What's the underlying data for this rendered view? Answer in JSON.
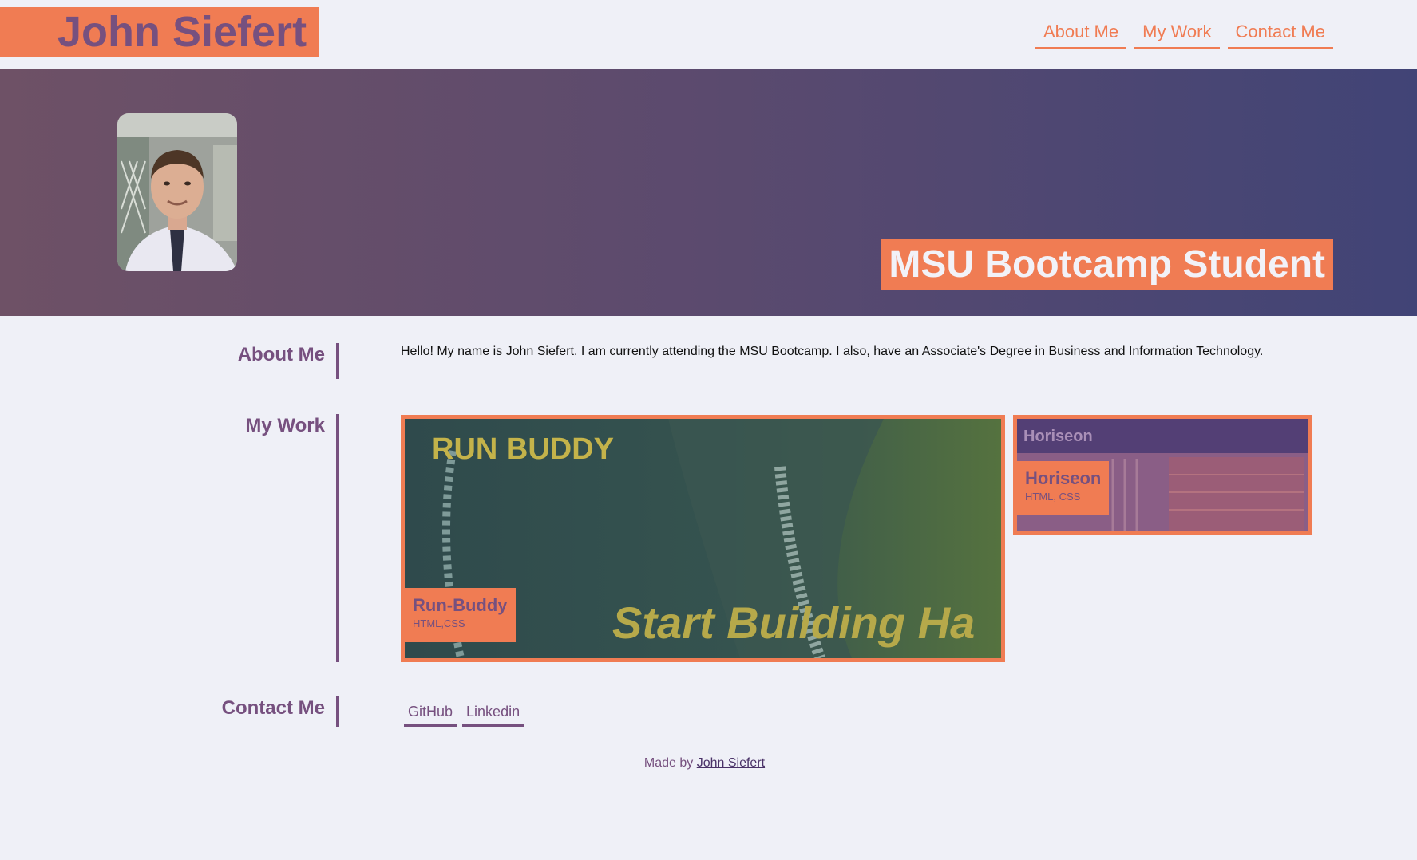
{
  "header": {
    "brand": "John Siefert",
    "nav": [
      {
        "label": "About Me"
      },
      {
        "label": "My Work"
      },
      {
        "label": "Contact Me"
      }
    ]
  },
  "hero": {
    "avatar_icon": "profile-photo",
    "title": "MSU Bootcamp Student"
  },
  "about": {
    "heading": "About Me",
    "text": "Hello! My name is John Siefert. I am currently attending the MSU Bootcamp. I also, have an Associate's Degree in Business and Information Technology."
  },
  "work": {
    "heading": "My Work",
    "projects": [
      {
        "name": "Run-Buddy",
        "tech": "HTML,CSS",
        "image_text_top": "RUN BUDDY",
        "image_text_bottom": "Start Building Ha"
      },
      {
        "name": "Horiseon",
        "tech": "HTML, CSS",
        "image_text_top": "Horiseon"
      }
    ]
  },
  "contact": {
    "heading": "Contact Me",
    "links": [
      {
        "label": "GitHub"
      },
      {
        "label": "Linkedin"
      }
    ]
  },
  "footer": {
    "prefix": "Made by ",
    "author": "John Siefert"
  },
  "colors": {
    "accent": "#f07c53",
    "primary": "#76507f",
    "background": "#eff0f7"
  }
}
